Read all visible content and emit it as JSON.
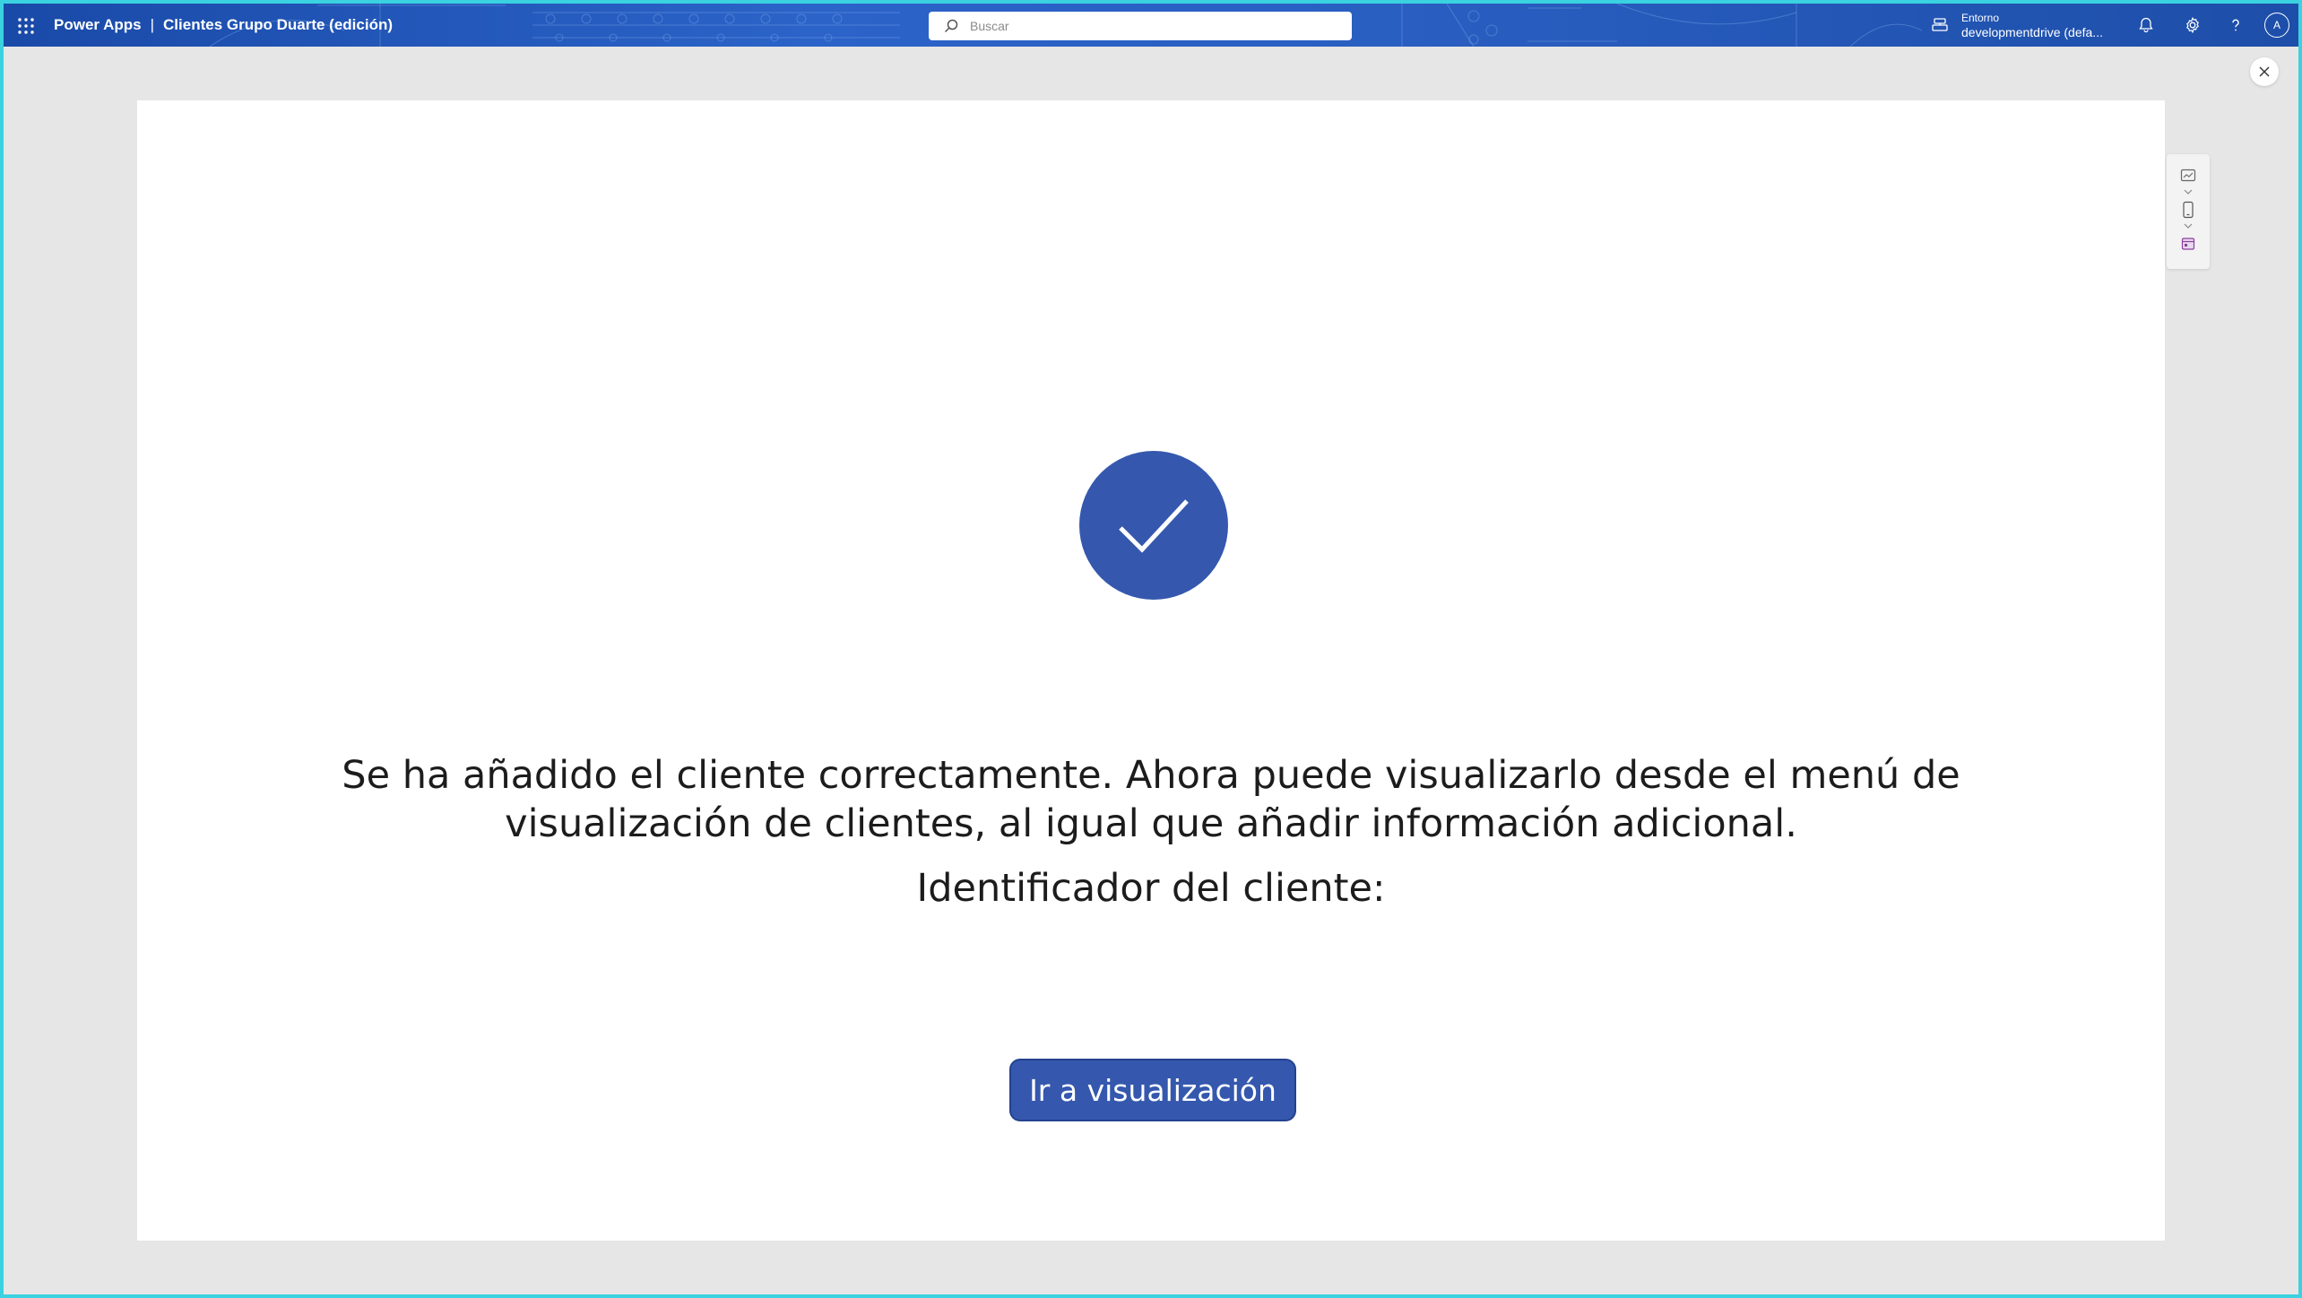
{
  "header": {
    "app_name": "Power Apps",
    "separator": "|",
    "app_title": "Clientes Grupo Duarte (edición)",
    "search_placeholder": "Buscar",
    "environment_label": "Entorno",
    "environment_value": "developmentdrive (defa...",
    "avatar_initial": "A",
    "icons": [
      "waffle-icon",
      "search-icon",
      "environment-icon",
      "bell-icon",
      "gear-icon",
      "help-icon"
    ]
  },
  "screen": {
    "message": "Se ha añadido el cliente correctamente. Ahora puede visualizarlo desde el menú de visualización de clientes, al igual que añadir información adicional.",
    "identifier_label": "Identificador del cliente:",
    "button_label": "Ir a visualización",
    "accent_color": "#3558ae"
  },
  "side_panel": {
    "icons": [
      "screen-layout-icon",
      "phone-preview-icon",
      "calendar-icon"
    ]
  },
  "colors": {
    "topbar": "#2b63c8",
    "background": "#e6e6e6",
    "canvas": "#ffffff",
    "accent": "#3558ae"
  }
}
